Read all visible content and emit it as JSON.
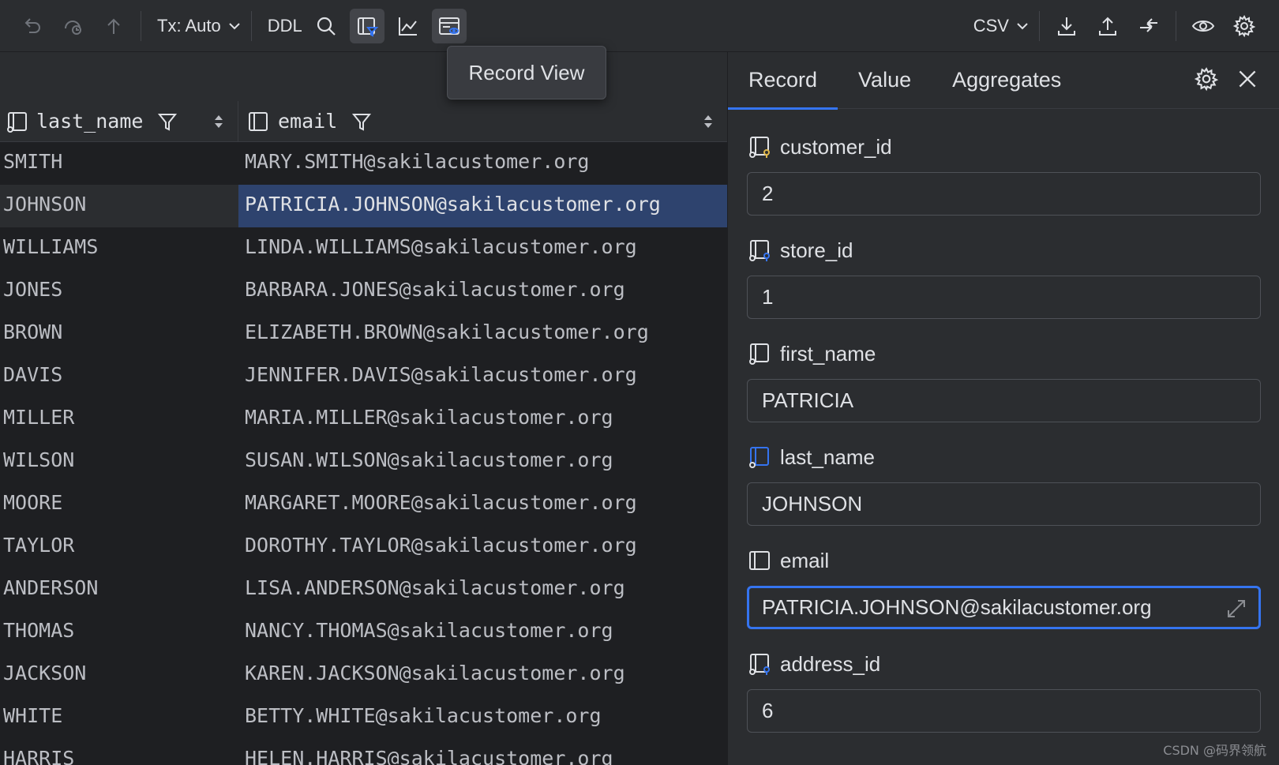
{
  "toolbar": {
    "tx_label": "Tx: Auto",
    "ddl_label": "DDL",
    "format_label": "CSV"
  },
  "tooltip": {
    "text": "Record View"
  },
  "grid": {
    "columns": [
      {
        "name": "last_name"
      },
      {
        "name": "email"
      }
    ],
    "rows": [
      {
        "last_name": "SMITH",
        "email": "MARY.SMITH@sakilacustomer.org"
      },
      {
        "last_name": "JOHNSON",
        "email": "PATRICIA.JOHNSON@sakilacustomer.org"
      },
      {
        "last_name": "WILLIAMS",
        "email": "LINDA.WILLIAMS@sakilacustomer.org"
      },
      {
        "last_name": "JONES",
        "email": "BARBARA.JONES@sakilacustomer.org"
      },
      {
        "last_name": "BROWN",
        "email": "ELIZABETH.BROWN@sakilacustomer.org"
      },
      {
        "last_name": "DAVIS",
        "email": "JENNIFER.DAVIS@sakilacustomer.org"
      },
      {
        "last_name": "MILLER",
        "email": "MARIA.MILLER@sakilacustomer.org"
      },
      {
        "last_name": "WILSON",
        "email": "SUSAN.WILSON@sakilacustomer.org"
      },
      {
        "last_name": "MOORE",
        "email": "MARGARET.MOORE@sakilacustomer.org"
      },
      {
        "last_name": "TAYLOR",
        "email": "DOROTHY.TAYLOR@sakilacustomer.org"
      },
      {
        "last_name": "ANDERSON",
        "email": "LISA.ANDERSON@sakilacustomer.org"
      },
      {
        "last_name": "THOMAS",
        "email": "NANCY.THOMAS@sakilacustomer.org"
      },
      {
        "last_name": "JACKSON",
        "email": "KAREN.JACKSON@sakilacustomer.org"
      },
      {
        "last_name": "WHITE",
        "email": "BETTY.WHITE@sakilacustomer.org"
      },
      {
        "last_name": "HARRIS",
        "email": "HELEN.HARRIS@sakilacustomer.org"
      }
    ]
  },
  "panel": {
    "tabs": [
      {
        "label": "Record"
      },
      {
        "label": "Value"
      },
      {
        "label": "Aggregates"
      }
    ],
    "fields": [
      {
        "label": "customer_id",
        "value": "2"
      },
      {
        "label": "store_id",
        "value": "1"
      },
      {
        "label": "first_name",
        "value": "PATRICIA"
      },
      {
        "label": "last_name",
        "value": "JOHNSON"
      },
      {
        "label": "email",
        "value": "PATRICIA.JOHNSON@sakilacustomer.org"
      },
      {
        "label": "address_id",
        "value": "6"
      }
    ]
  },
  "watermark": "CSDN @码界领航",
  "colors": {
    "background": "#1e1f22",
    "panel": "#2b2d30",
    "selection": "#2e436e",
    "focus": "#3574f0"
  }
}
